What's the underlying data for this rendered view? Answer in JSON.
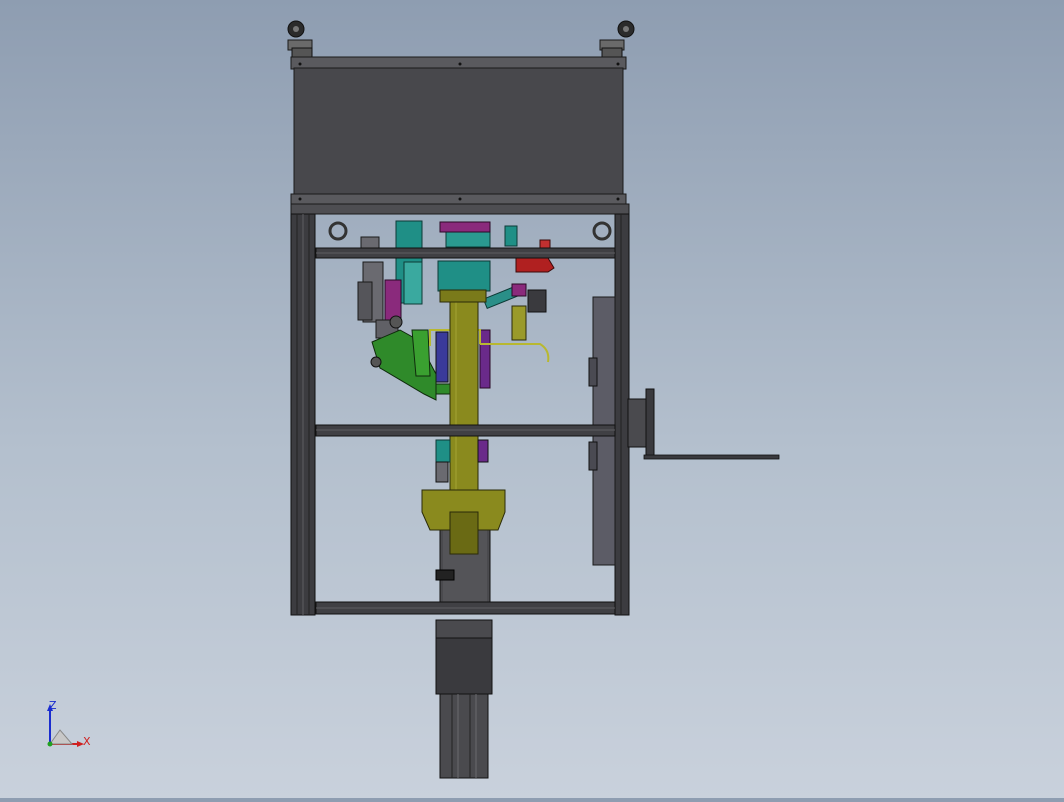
{
  "viewport": {
    "background_top": "#8e9db1",
    "background_bottom": "#c9d1dc"
  },
  "model": {
    "components": [
      "cabinet-box",
      "caster-wheel",
      "frame-upright",
      "crossbar",
      "lifting-ring",
      "teal-actuator",
      "magenta-bracket",
      "yellow-column",
      "yellow-clamp",
      "green-arm",
      "red-lever",
      "side-panel",
      "motor-plate",
      "probe-rod",
      "cylinder-housing",
      "motor-block",
      "linear-guide"
    ],
    "colors": {
      "cabinet": "#4a4a4e",
      "frame": "#3c3c40",
      "teal": "#1f8f86",
      "magenta": "#8a2a7c",
      "yellow": "#8a8a1e",
      "green": "#2f8a2a",
      "red": "#b02020",
      "panel": "#5c5c66"
    }
  },
  "triad": {
    "z_label": "Z",
    "x_label": "X",
    "z_color": "#1a2ccf",
    "x_color": "#cf2020"
  }
}
